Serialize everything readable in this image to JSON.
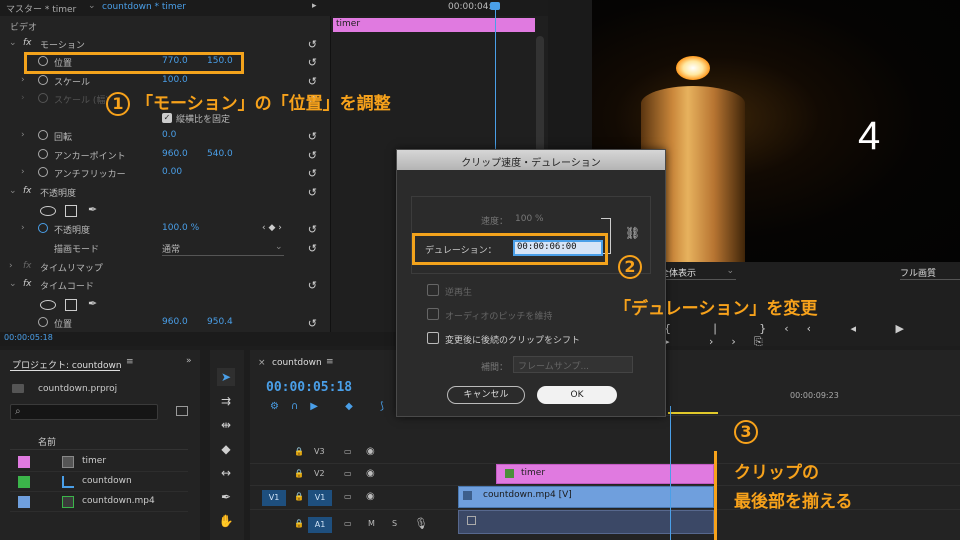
{
  "effect_controls": {
    "tab_master": "マスター * timer",
    "tab_seq": "countdown * timer",
    "playhead_time": "00:00:04:2",
    "clip_name": "timer",
    "section_video": "ビデオ",
    "motion": "モーション",
    "position_label": "位置",
    "position_x": "770.0",
    "position_y": "150.0",
    "scale_label": "スケール",
    "scale_value": "100.0",
    "scale_w_label": "スケール (幅)",
    "uniform_label": "縦横比を固定",
    "rotation_label": "回転",
    "rotation_value": "0.0",
    "anchor_label": "アンカーポイント",
    "anchor_x": "960.0",
    "anchor_y": "540.0",
    "flicker_label": "アンチフリッカー",
    "flicker_value": "0.00",
    "opacity_section": "不透明度",
    "opacity_label": "不透明度",
    "opacity_value": "100.0 %",
    "blend_label": "描画モード",
    "blend_value": "通常",
    "time_remap": "タイムリマップ",
    "timecode_section": "タイムコード",
    "tc_position_label": "位置",
    "tc_position_x": "960.0",
    "tc_position_y": "950.4",
    "footer_time": "00:00:05:18"
  },
  "program": {
    "countdown_number": "4",
    "zoom_select": "全体表示",
    "quality_select": "フル画質",
    "ruler_time": "00:00:09:23"
  },
  "project": {
    "title": "プロジェクト: countdown",
    "project_file": "countdown.prproj",
    "col_name": "名前",
    "items": [
      {
        "name": "timer",
        "color": "#e07ae0"
      },
      {
        "name": "countdown",
        "color": "#3bb54a"
      },
      {
        "name": "countdown.mp4",
        "color": "#6f9fdd"
      }
    ]
  },
  "timeline": {
    "tab": "countdown",
    "timecode": "00:00:05:18",
    "tracks": [
      {
        "name": "V3"
      },
      {
        "name": "V2"
      },
      {
        "name": "V1",
        "source": "V1"
      },
      {
        "name": "A1"
      }
    ],
    "clip_timer": "timer",
    "clip_mp4": "countdown.mp4 [V]",
    "mute": "M",
    "solo": "S"
  },
  "dialog": {
    "title": "クリップ速度・デュレーション",
    "speed_label": "速度：",
    "speed_value": "100 %",
    "duration_label": "デュレーション：",
    "duration_value": "00:00:06:00",
    "reverse": "逆再生",
    "pitch": "オーディオのピッチを維持",
    "ripple": "変更後に後続のクリップをシフト",
    "interp_label": "補間：",
    "interp_value": "フレームサンプ...",
    "cancel": "キャンセル",
    "ok": "OK"
  },
  "annotations": {
    "a1_num": "1",
    "a1_text": "「モーション」の「位置」を調整",
    "a2_num": "2",
    "a2_text": "「デュレーション」を変更",
    "a3_num": "3",
    "a3_line1": "クリップの",
    "a3_line2": "最後部を揃える"
  },
  "colors": {
    "accent": "#f7a21b",
    "clip_pink": "#e07ae0",
    "clip_blue": "#6f9fdd",
    "timecode_blue": "#4a9fe8"
  }
}
